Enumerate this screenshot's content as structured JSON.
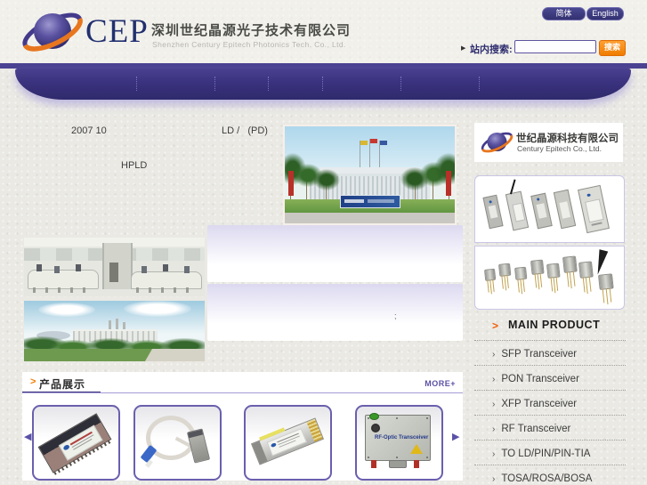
{
  "header": {
    "logo_cep": "CEP",
    "company_name_cn": "深圳世纪晶源光子技术有限公司",
    "company_name_en": "Shenzhen Century Epitech Photonics Tech. Co., Ltd.",
    "lang_simplified": "简体",
    "lang_english": "English",
    "search_label": "站内搜索:",
    "search_button": "搜索",
    "search_value": ""
  },
  "news": {
    "line1_left": "2007 10",
    "line1_right": "LD /   (PD)",
    "line2": "HPLD",
    "panel_note": ";"
  },
  "showcase": {
    "title": "产品展示",
    "more_link": "MORE+"
  },
  "carousel": {
    "items": [
      {
        "name": "SFP optical transceiver module"
      },
      {
        "name": "fiber patch cord with transceiver"
      },
      {
        "name": "XFP optical transceiver module"
      },
      {
        "name": "RF optic transceiver unit",
        "label": "RF-Optic Transceiver"
      }
    ]
  },
  "sidebar": {
    "logo_cn": "世纪晶源科技有限公司",
    "logo_en": "Century Epitech Co., Ltd.",
    "main_product_title": "MAIN PRODUCT",
    "menu": [
      {
        "label": "SFP Transceiver"
      },
      {
        "label": "PON Transceiver"
      },
      {
        "label": "XFP Transceiver"
      },
      {
        "label": "RF Transceiver"
      },
      {
        "label": "TO LD/PIN/PIN-TIA"
      },
      {
        "label": "TOSA/ROSA/BOSA"
      }
    ]
  },
  "icons": {
    "search_pointer": "▶",
    "title_arrow": ">",
    "main_bullet": ">",
    "menu_bullet": "›",
    "prev": "◀",
    "next": "▶"
  },
  "colors": {
    "nav_purple": "#3a327e",
    "accent_orange": "#f07d00",
    "link_purple": "#5b51a5"
  }
}
